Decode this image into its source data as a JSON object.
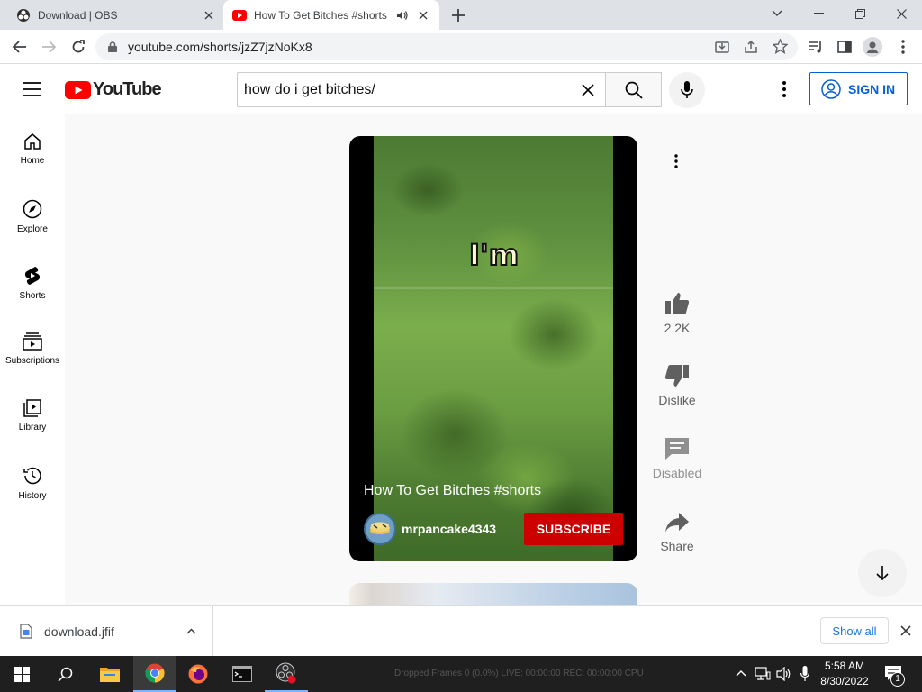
{
  "browser": {
    "tabs": [
      {
        "title": "Download | OBS",
        "active": false
      },
      {
        "title": "How To Get Bitches #shorts",
        "active": true
      }
    ],
    "url": "youtube.com/shorts/jzZ7jzNoKx8"
  },
  "youtube": {
    "logo_text": "YouTube",
    "search_value": "how do i get bitches/",
    "sign_in_label": "SIGN IN",
    "guide": [
      {
        "label": "Home",
        "icon": "home-icon"
      },
      {
        "label": "Explore",
        "icon": "compass-icon"
      },
      {
        "label": "Shorts",
        "icon": "shorts-icon"
      },
      {
        "label": "Subscriptions",
        "icon": "subscriptions-icon"
      },
      {
        "label": "Library",
        "icon": "library-icon"
      },
      {
        "label": "History",
        "icon": "history-icon"
      }
    ],
    "short": {
      "caption_overlay": "I'm",
      "title": "How To Get Bitches #shorts",
      "channel": "mrpancake4343",
      "subscribe_label": "SUBSCRIBE",
      "likes": "2.2K",
      "dislike_label": "Dislike",
      "comments_label": "Disabled",
      "share_label": "Share"
    }
  },
  "download_bar": {
    "file_name": "download.jfif",
    "show_all_label": "Show all"
  },
  "taskbar": {
    "obs_status": "Dropped Frames 0 (0.0%)    LIVE: 00:00:00    REC: 00:00:00    CPU",
    "time": "5:58 AM",
    "date": "8/30/2022",
    "notification_count": "1"
  },
  "colors": {
    "youtube_red": "#ff0000",
    "subscribe_red": "#cc0000",
    "link_blue": "#065fd4"
  }
}
